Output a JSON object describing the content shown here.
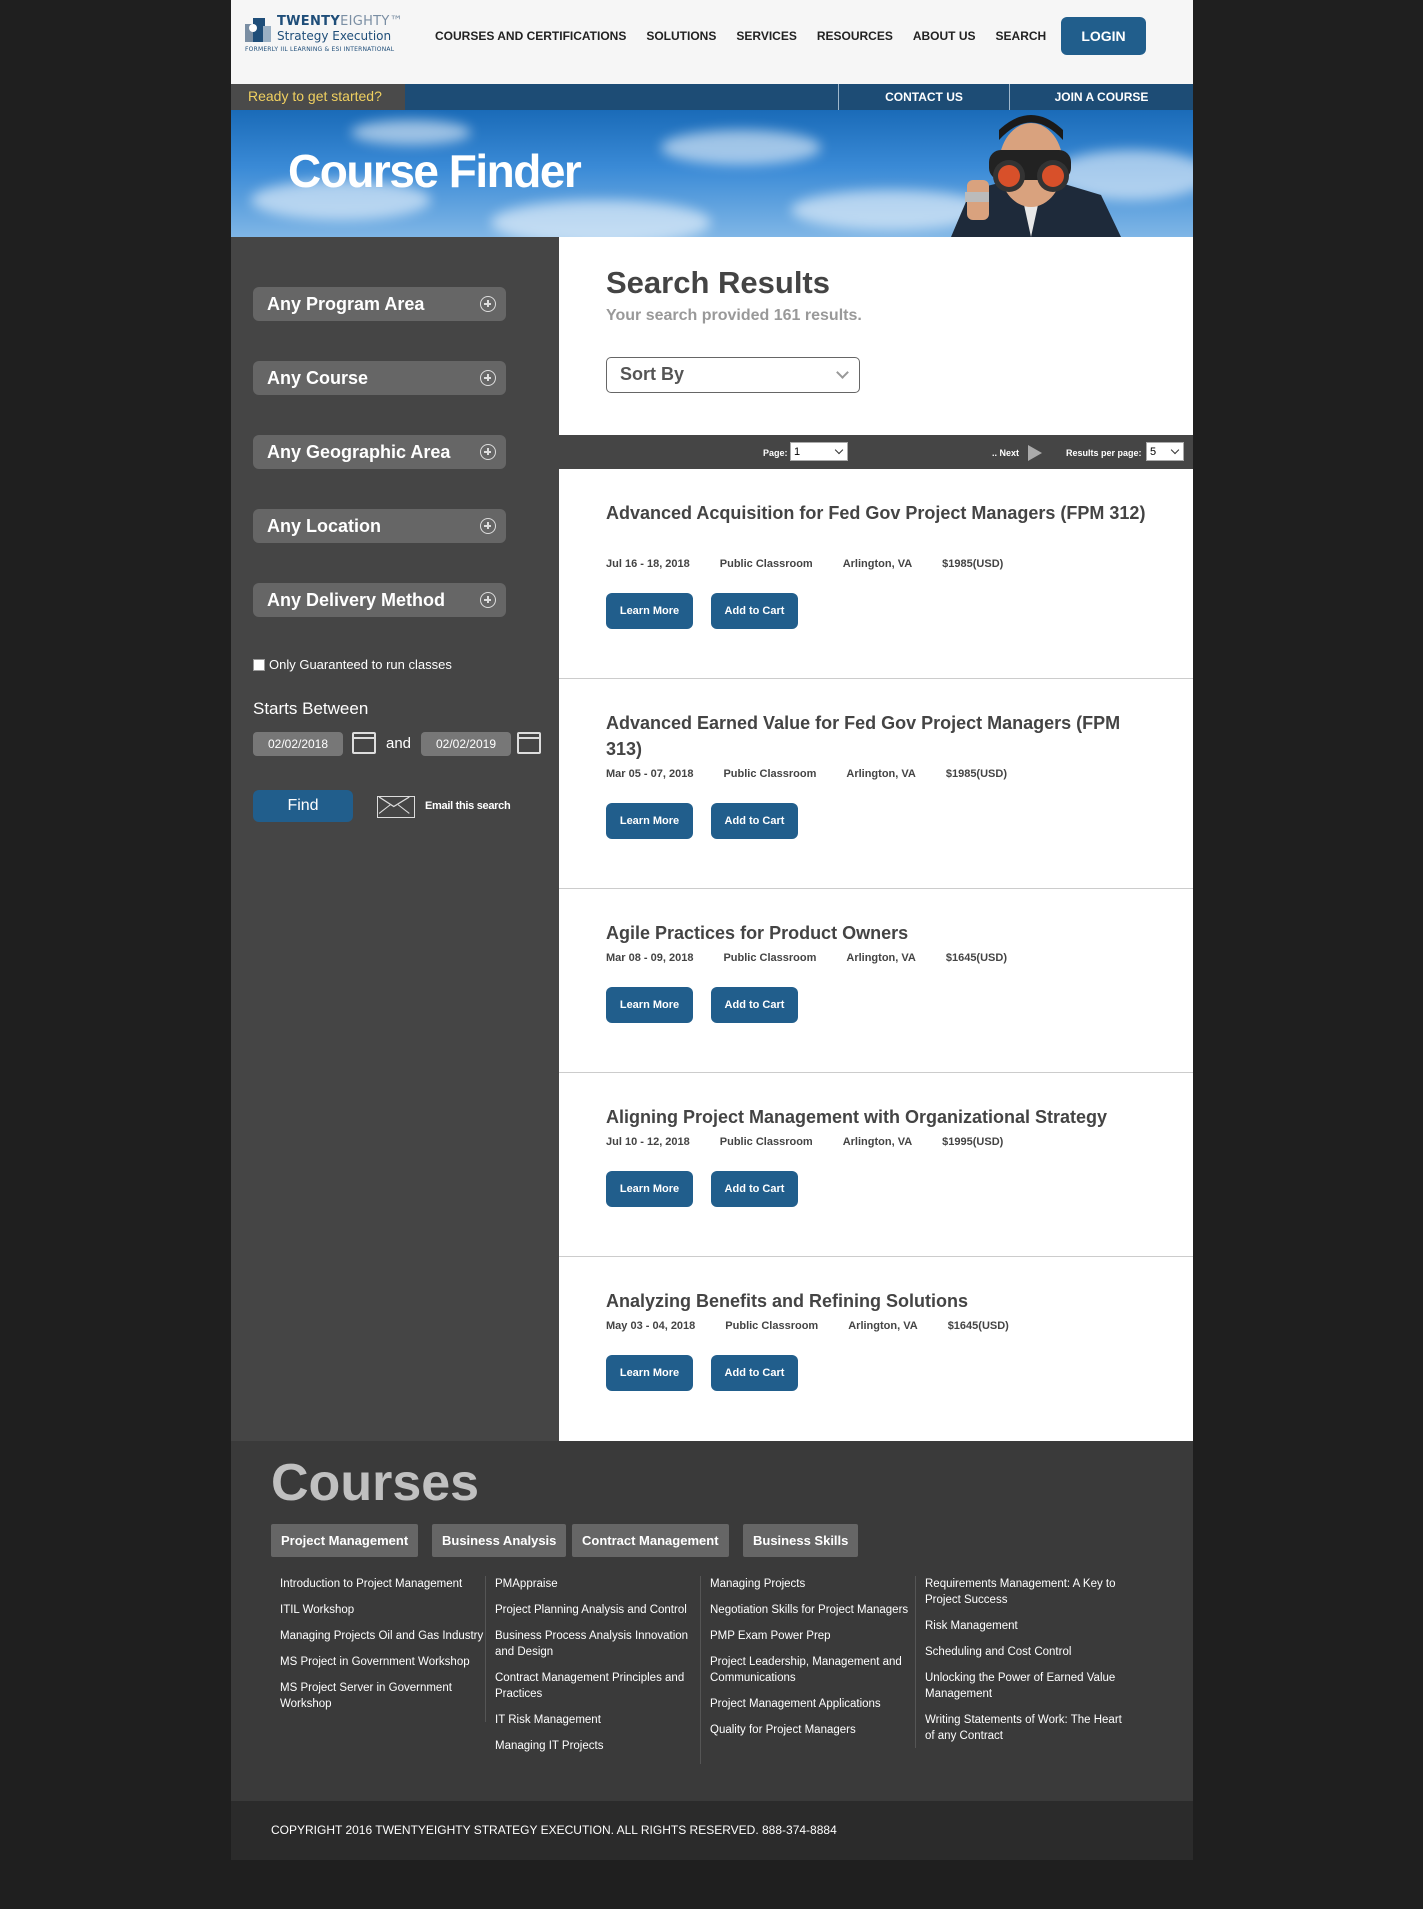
{
  "header": {
    "logo": {
      "brand_bold": "TWENTY",
      "brand_light": "EIGHTY™",
      "tagline": "Strategy Execution",
      "formerly": "FORMERLY IIL LEARNING & ESI INTERNATIONAL"
    },
    "nav": [
      "COURSES AND CERTIFICATIONS",
      "SOLUTIONS",
      "SERVICES",
      "RESOURCES",
      "ABOUT US",
      "SEARCH"
    ],
    "login_label": "LOGIN"
  },
  "subbar": {
    "ready": "Ready to get started?",
    "contact": "CONTACT US",
    "join": "JOIN A COURSE"
  },
  "banner": {
    "title": "Course Finder"
  },
  "sidebar": {
    "filters": [
      "Any Program Area",
      "Any Course",
      "Any Geographic Area",
      "Any Location",
      "Any Delivery Method"
    ],
    "guaranteed_label": "Only Guaranteed to run classes",
    "starts_label": "Starts Between",
    "date_from": "02/02/2018",
    "and_label": "and",
    "date_to": "02/02/2019",
    "find_label": "Find",
    "email_label": "Email this search"
  },
  "results_header": {
    "title": "Search Results",
    "subtitle": "Your search provided 161 results.",
    "sort_label": "Sort By"
  },
  "pager": {
    "page_label": "Page:",
    "page_value": "1",
    "next_label": ".. Next",
    "rpp_label": "Results per page:",
    "rpp_value": "5"
  },
  "results": [
    {
      "title": "Advanced Acquisition for Fed Gov Project Managers (FPM 312)",
      "dates": "Jul 16 - 18, 2018",
      "type": "Public Classroom",
      "location": "Arlington, VA",
      "price": "$1985(USD)"
    },
    {
      "title": "Advanced Earned Value for Fed Gov Project Managers (FPM 313)",
      "dates": "Mar 05 - 07, 2018",
      "type": "Public Classroom",
      "location": "Arlington, VA",
      "price": "$1985(USD)"
    },
    {
      "title": "Agile Practices for Product Owners",
      "dates": "Mar 08 - 09, 2018",
      "type": "Public Classroom",
      "location": "Arlington, VA",
      "price": "$1645(USD)"
    },
    {
      "title": "Aligning Project Management with Organizational Strategy",
      "dates": "Jul 10 - 12, 2018",
      "type": "Public Classroom",
      "location": "Arlington, VA",
      "price": "$1995(USD)"
    },
    {
      "title": "Analyzing Benefits and Refining Solutions",
      "dates": "May 03 - 04, 2018",
      "type": "Public Classroom",
      "location": "Arlington, VA",
      "price": "$1645(USD)"
    }
  ],
  "result_buttons": {
    "learn_more": "Learn More",
    "add_to_cart": "Add to Cart"
  },
  "footer": {
    "title": "Courses",
    "tabs": [
      "Project Management",
      "Business Analysis",
      "Contract Management",
      "Business Skills"
    ],
    "columns": [
      [
        "Introduction to Project Management",
        "ITIL Workshop",
        "Managing Projects Oil and Gas Industry",
        "MS Project in Government Workshop",
        "MS Project Server in Government Workshop"
      ],
      [
        "PMAppraise",
        "Project Planning Analysis and Control",
        "Business Process Analysis Innovation and Design",
        "Contract Management Principles and Practices",
        "IT Risk Management",
        "Managing IT Projects"
      ],
      [
        "Managing Projects",
        "Negotiation Skills for Project Managers",
        "PMP Exam Power Prep",
        "Project Leadership, Management and Communications",
        "Project Management Applications",
        "Quality for Project Managers"
      ],
      [
        "Requirements Management: A Key to Project Success",
        "Risk Management",
        "Scheduling and Cost Control",
        "Unlocking the Power of Earned Value Management",
        "Writing Statements of Work: The Heart of any Contract"
      ]
    ],
    "copyright": "COPYRIGHT 2016 TWENTYEIGHTY STRATEGY EXECUTION. ALL RIGHTS RESERVED. 888-374-8884"
  },
  "colors": {
    "accent": "#215e8c",
    "subbar": "#1d4c75",
    "panel": "#454545",
    "ready_text": "#f0d060"
  }
}
